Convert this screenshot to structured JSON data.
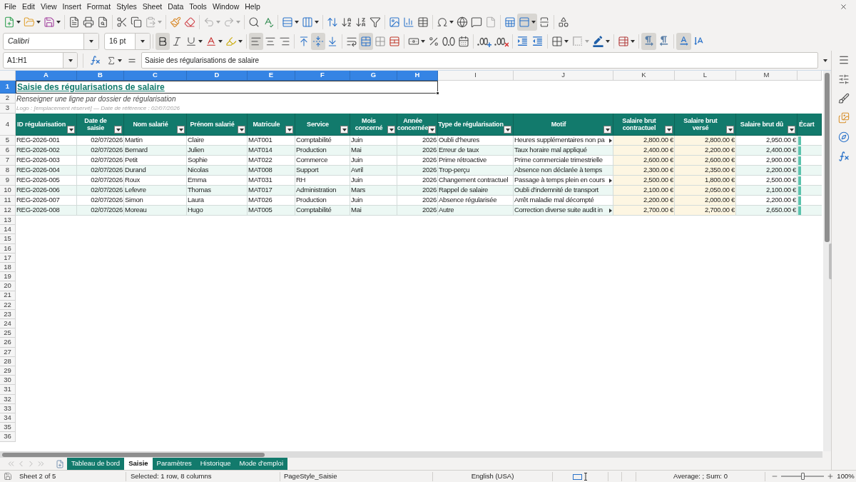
{
  "menu": {
    "items": [
      "File",
      "Edit",
      "View",
      "Insert",
      "Format",
      "Styles",
      "Sheet",
      "Data",
      "Tools",
      "Window",
      "Help"
    ]
  },
  "standard_toolbar": {
    "paste_disabled": true,
    "undo_disabled": true,
    "redo_disabled": true,
    "header_footer_disabled": true,
    "freeze_on": true
  },
  "formatting_toolbar": {
    "font_name": "Calibri",
    "font_size": "16 pt",
    "bold": true,
    "italic": false,
    "underline": false,
    "align_left": true,
    "align_center": false,
    "align_right": false,
    "align_top": false,
    "align_middle": true,
    "align_bottom": false,
    "wrap_text": false,
    "merge_center": true,
    "border_style_disabled": true,
    "ltr": true,
    "rtl": false,
    "text_horizontal": true,
    "text_vertical": false
  },
  "formula_bar": {
    "name_box": "A1:H1",
    "content": "Saisie des régularisations de salaire"
  },
  "sheet": {
    "columns": [
      {
        "label": "A",
        "selected": true
      },
      {
        "label": "B",
        "selected": true
      },
      {
        "label": "C",
        "selected": true
      },
      {
        "label": "D",
        "selected": true
      },
      {
        "label": "E",
        "selected": true
      },
      {
        "label": "F",
        "selected": true
      },
      {
        "label": "G",
        "selected": true
      },
      {
        "label": "H",
        "selected": true
      },
      {
        "label": "I",
        "selected": false
      },
      {
        "label": "J",
        "selected": false
      },
      {
        "label": "K",
        "selected": false
      },
      {
        "label": "L",
        "selected": false
      },
      {
        "label": "M",
        "selected": false
      },
      {
        "selected": false
      }
    ],
    "rows": [
      {
        "kind": "title",
        "label": "1",
        "selected": true,
        "text": "Saisie des régularisations de salaire"
      },
      {
        "kind": "subtitle",
        "label": "2",
        "selected": false,
        "text": "Renseigner une ligne par dossier de régularisation"
      },
      {
        "kind": "note",
        "label": "3",
        "selected": false,
        "text": "Logo : [emplacement réservé] — Date de référence : 02/07/2026"
      },
      {
        "kind": "header",
        "label": "4",
        "selected": false,
        "cells": [
          {
            "text": "ID régularisation",
            "filter": true
          },
          {
            "text": "Date de saisie",
            "filter": true
          },
          {
            "text": "Nom salarié",
            "filter": true
          },
          {
            "text": "Prénom salarié",
            "filter": true
          },
          {
            "text": "Matricule",
            "filter": true
          },
          {
            "text": "Service",
            "filter": true
          },
          {
            "text": "Mois concerné",
            "filter": true
          },
          {
            "text": "Année concernée",
            "filter": true
          },
          {
            "text": "Type de régularisation",
            "filter": true
          },
          {
            "text": "Motif",
            "filter": true
          },
          {
            "text": "Salaire brut contractuel",
            "filter": true
          },
          {
            "text": "Salaire brut versé",
            "filter": true
          },
          {
            "text": "Salaire brut dû",
            "filter": true
          },
          {
            "text": "Écart",
            "filter": false
          }
        ]
      },
      {
        "kind": "data",
        "label": "5",
        "selected": false,
        "striped": false,
        "overflow": true,
        "cells": [
          "REG-2026-001",
          "02/07/2026",
          "Martin",
          "Claire",
          "MAT001",
          "Comptabilité",
          "Juin",
          "2026",
          "Oubli d'heures",
          "Heures supplémentaires non pa",
          "2,800.00 €",
          "2,800.00 €",
          "2,950.00 €"
        ]
      },
      {
        "kind": "data",
        "label": "6",
        "selected": false,
        "striped": true,
        "overflow": false,
        "cells": [
          "REG-2026-002",
          "02/07/2026",
          "Bernard",
          "Julien",
          "MAT014",
          "Production",
          "Mai",
          "2026",
          "Erreur de taux",
          "Taux horaire mal appliqué",
          "2,400.00 €",
          "2,200.00 €",
          "2,400.00 €"
        ]
      },
      {
        "kind": "data",
        "label": "7",
        "selected": false,
        "striped": false,
        "overflow": false,
        "cells": [
          "REG-2026-003",
          "02/07/2026",
          "Petit",
          "Sophie",
          "MAT022",
          "Commerce",
          "Juin",
          "2026",
          "Prime rétroactive",
          "Prime commerciale trimestrielle",
          "2,600.00 €",
          "2,600.00 €",
          "2,900.00 €"
        ]
      },
      {
        "kind": "data",
        "label": "8",
        "selected": false,
        "striped": true,
        "overflow": false,
        "cells": [
          "REG-2026-004",
          "02/07/2026",
          "Durand",
          "Nicolas",
          "MAT008",
          "Support",
          "Avril",
          "2026",
          "Trop-perçu",
          "Absence non déclarée à temps",
          "2,300.00 €",
          "2,350.00 €",
          "2,200.00 €"
        ]
      },
      {
        "kind": "data",
        "label": "9",
        "selected": false,
        "striped": false,
        "overflow": true,
        "cells": [
          "REG-2026-005",
          "02/07/2026",
          "Roux",
          "Emma",
          "MAT031",
          "RH",
          "Juin",
          "2026",
          "Changement contractuel",
          "Passage à temps plein en cours",
          "2,500.00 €",
          "1,800.00 €",
          "2,500.00 €"
        ]
      },
      {
        "kind": "data",
        "label": "10",
        "selected": false,
        "striped": true,
        "overflow": false,
        "cells": [
          "REG-2026-006",
          "02/07/2026",
          "Lefevre",
          "Thomas",
          "MAT017",
          "Administration",
          "Mars",
          "2026",
          "Rappel de salaire",
          "Oubli d'indemnité de transport",
          "2,100.00 €",
          "2,050.00 €",
          "2,100.00 €"
        ]
      },
      {
        "kind": "data",
        "label": "11",
        "selected": false,
        "striped": false,
        "overflow": false,
        "cells": [
          "REG-2026-007",
          "02/07/2026",
          "Simon",
          "Laura",
          "MAT026",
          "Production",
          "Juin",
          "2026",
          "Absence régularisée",
          "Arrêt maladie mal décompté",
          "2,200.00 €",
          "2,000.00 €",
          "2,200.00 €"
        ]
      },
      {
        "kind": "data",
        "label": "12",
        "selected": false,
        "striped": true,
        "overflow": true,
        "cells": [
          "REG-2026-008",
          "02/07/2026",
          "Moreau",
          "Hugo",
          "MAT005",
          "Comptabilité",
          "Mai",
          "2026",
          "Autre",
          "Correction diverse suite audit in",
          "2,700.00 €",
          "2,700.00 €",
          "2,650.00 €"
        ]
      },
      {
        "kind": "empty",
        "label": "13",
        "selected": false
      },
      {
        "kind": "empty",
        "label": "14",
        "selected": false
      },
      {
        "kind": "empty",
        "label": "15",
        "selected": false
      },
      {
        "kind": "empty",
        "label": "16",
        "selected": false
      },
      {
        "kind": "empty",
        "label": "17",
        "selected": false
      },
      {
        "kind": "empty",
        "label": "18",
        "selected": false
      },
      {
        "kind": "empty",
        "label": "19",
        "selected": false
      },
      {
        "kind": "empty",
        "label": "20",
        "selected": false
      },
      {
        "kind": "empty",
        "label": "21",
        "selected": false
      },
      {
        "kind": "empty",
        "label": "22",
        "selected": false
      },
      {
        "kind": "empty",
        "label": "23",
        "selected": false
      },
      {
        "kind": "empty",
        "label": "24",
        "selected": false
      },
      {
        "kind": "empty",
        "label": "25",
        "selected": false
      },
      {
        "kind": "empty",
        "label": "26",
        "selected": false
      },
      {
        "kind": "empty",
        "label": "27",
        "selected": false
      },
      {
        "kind": "empty",
        "label": "28",
        "selected": false
      },
      {
        "kind": "empty",
        "label": "29",
        "selected": false
      },
      {
        "kind": "empty",
        "label": "30",
        "selected": false
      },
      {
        "kind": "empty",
        "label": "31",
        "selected": false
      },
      {
        "kind": "empty",
        "label": "32",
        "selected": false
      },
      {
        "kind": "empty",
        "label": "33",
        "selected": false
      },
      {
        "kind": "empty",
        "label": "34",
        "selected": false
      },
      {
        "kind": "empty",
        "label": "35",
        "selected": false
      },
      {
        "kind": "empty",
        "label": "36",
        "selected": false
      }
    ]
  },
  "sheet_tabs": {
    "nav_disabled": true,
    "tabs": [
      {
        "label": "Tableau de bord",
        "selected": false
      },
      {
        "label": "Saisie",
        "selected": true
      },
      {
        "label": "Paramètres",
        "selected": false
      },
      {
        "label": "Historique",
        "selected": false
      },
      {
        "label": "Mode d'emploi",
        "selected": false
      }
    ]
  },
  "status_bar": {
    "sheet": "Sheet 2 of 5",
    "selection": "Selected: 1 row, 8 columns",
    "page_style": "PageStyle_Saisie",
    "language": "English (USA)",
    "summary": "Average: ; Sum: 0",
    "zoom": {
      "level": 0.5,
      "reading": "100%"
    }
  }
}
